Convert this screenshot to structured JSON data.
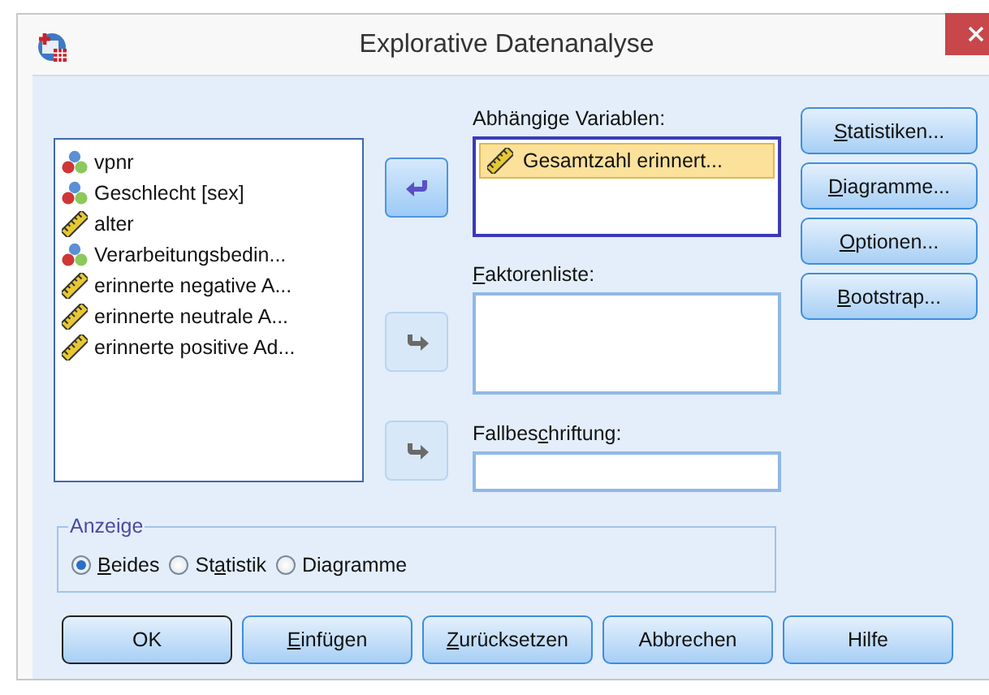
{
  "window": {
    "title": "Explorative Datenanalyse"
  },
  "source_variables": [
    {
      "name": "vpnr",
      "kind": "nominal"
    },
    {
      "name": "Geschlecht [sex]",
      "kind": "nominal"
    },
    {
      "name": "alter",
      "kind": "scale"
    },
    {
      "name": "Verarbeitungsbedin...",
      "kind": "nominal"
    },
    {
      "name": "erinnerte negative A...",
      "kind": "scale"
    },
    {
      "name": "erinnerte neutrale A...",
      "kind": "scale"
    },
    {
      "name": "erinnerte positive Ad...",
      "kind": "scale"
    }
  ],
  "move_buttons": [
    {
      "kind": "remove",
      "disabled": false
    },
    {
      "kind": "add",
      "disabled": true
    },
    {
      "kind": "add",
      "disabled": true
    }
  ],
  "dependent_list": {
    "label": {
      "before": "Abhängige Variablen:"
    },
    "items": [
      {
        "name": "Gesamtzahl erinnert...",
        "kind": "scale",
        "selected": true
      }
    ]
  },
  "factor_list": {
    "label": {
      "key": "F",
      "after": "aktorenliste:"
    }
  },
  "label_cases": {
    "label": {
      "before": "Fallbes",
      "key": "c",
      "after": "hriftung:"
    }
  },
  "side_buttons": [
    {
      "key": "S",
      "after": "tatistiken..."
    },
    {
      "key": "D",
      "after": "iagramme..."
    },
    {
      "key": "O",
      "after": "ptionen..."
    },
    {
      "key": "B",
      "after": "ootstrap..."
    }
  ],
  "display_group": {
    "title": "Anzeige",
    "options": [
      {
        "label": {
          "key": "B",
          "after": "eides"
        },
        "selected": true
      },
      {
        "label": {
          "before": "St",
          "key": "a",
          "after": "tistik"
        },
        "selected": false
      },
      {
        "label": {
          "before": "Diagramme"
        },
        "selected": false
      }
    ]
  },
  "buttons": [
    {
      "label": {
        "before": "OK"
      },
      "default": true
    },
    {
      "label": {
        "key": "E",
        "after": "infügen"
      },
      "default": false
    },
    {
      "label": {
        "key": "Z",
        "after": "urücksetzen"
      },
      "default": false
    },
    {
      "label": {
        "before": "Abbrechen"
      },
      "default": false
    },
    {
      "label": {
        "before": "Hilfe"
      },
      "default": false
    }
  ]
}
